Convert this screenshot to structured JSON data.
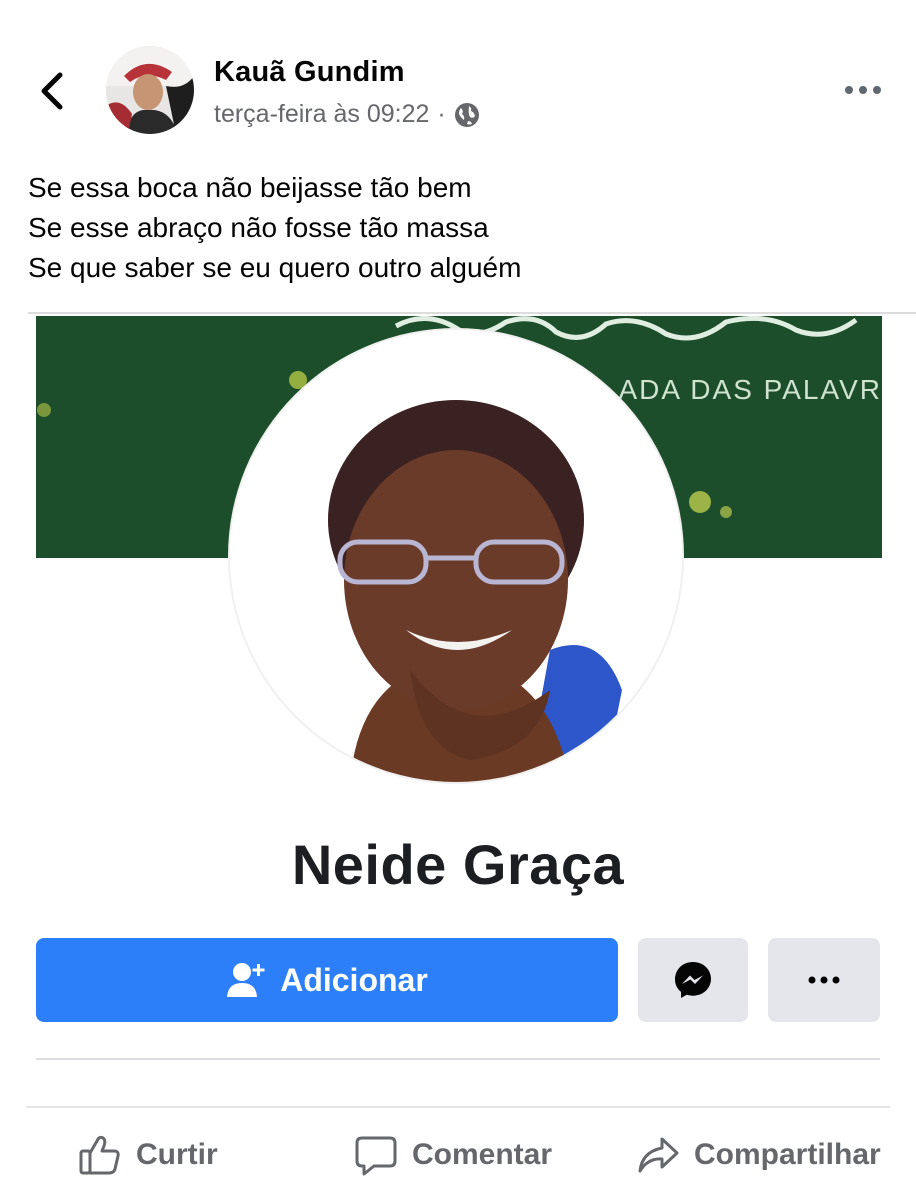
{
  "post": {
    "author": "Kauã Gundim",
    "timestamp": "terça-feira às 09:22",
    "separator": "·",
    "privacy_icon": "globe-icon",
    "text_lines": [
      "Se essa boca não beijasse tão bem",
      "Se esse abraço não fosse tão massa",
      "Se que saber se eu quero outro alguém"
    ]
  },
  "shared_image": {
    "cover_text": "ADA DAS PALAVR",
    "profile_name": "Neide Graça",
    "add_button_label": "Adicionar",
    "accent_color": "#2d7ff9"
  },
  "actions": {
    "like": "Curtir",
    "comment": "Comentar",
    "share": "Compartilhar"
  }
}
